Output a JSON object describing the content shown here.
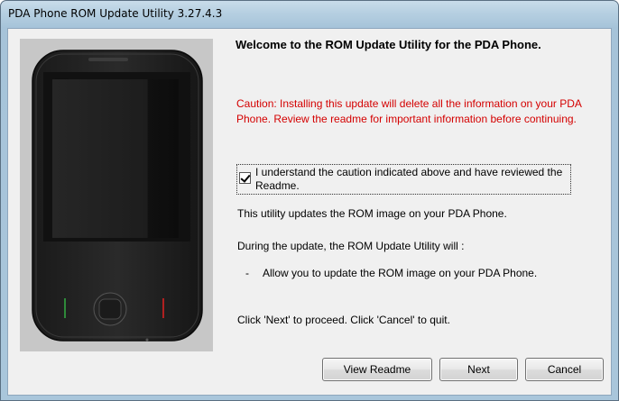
{
  "window": {
    "title": "PDA Phone ROM Update Utility 3.27.4.3"
  },
  "main": {
    "heading": "Welcome to the ROM Update Utility for the PDA Phone.",
    "caution": "Caution: Installing this update will delete all the information on your PDA Phone. Review the readme for important information before continuing.",
    "checkbox": {
      "label": "I understand the caution indicated above and have reviewed the Readme.",
      "checked": true
    },
    "info_1": "This utility updates the ROM image on your PDA Phone.",
    "info_2": "During the update, the ROM Update Utility will :",
    "bullet_dash": "-",
    "bullet_text": "Allow you to update the ROM image on your PDA Phone.",
    "instructions": "Click 'Next' to proceed. Click 'Cancel' to quit."
  },
  "buttons": {
    "view_readme": "View Readme",
    "next": "Next",
    "cancel": "Cancel"
  },
  "colors": {
    "caution_text": "#d40000",
    "panel_background": "#c7c7c7",
    "client_background": "#f0f0f0"
  }
}
